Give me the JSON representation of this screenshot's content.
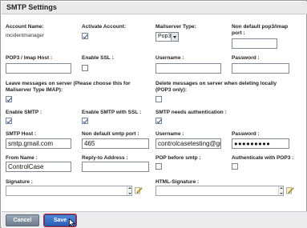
{
  "window": {
    "title": "SMTP Settings"
  },
  "fields": {
    "account_name": {
      "label": "Account Name:",
      "value": "incidentmanager"
    },
    "activate_account": {
      "label": "Activate Account:",
      "checked": true
    },
    "mailserver_type": {
      "label": "Mailserver Type:",
      "value": "Pop3"
    },
    "non_default_pop3_port": {
      "label": "Non default pop3/imap port :",
      "value": ""
    },
    "pop3_host": {
      "label": "POP3 / Imap Host :",
      "value": ""
    },
    "enable_ssl": {
      "label": "Enable SSL :",
      "checked": false
    },
    "username_pop": {
      "label": "Username :",
      "value": ""
    },
    "password_pop": {
      "label": "Password :",
      "value": ""
    },
    "leave_messages": {
      "label": "Leave messages on server (Please choose this for Mailserver Type IMAP):",
      "checked": true
    },
    "delete_messages": {
      "label": "Delete messages on server when deleting locally (POP3 only):",
      "checked": false
    },
    "enable_smtp": {
      "label": "Enable SMTP :",
      "checked": true
    },
    "enable_smtp_ssl": {
      "label": "Enable SMTP with SSL :",
      "checked": true
    },
    "smtp_needs_auth": {
      "label": "SMTP needs authentication :",
      "checked": true
    },
    "smtp_host": {
      "label": "SMTP Host :",
      "value": "smtp.gmail.com"
    },
    "non_default_smtp_port": {
      "label": "Non default smtp port :",
      "value": "465"
    },
    "username_smtp": {
      "label": "Username :",
      "value": "controlcasetesting@gmai"
    },
    "password_smtp": {
      "label": "Password :",
      "value": "●●●●●●●●●"
    },
    "from_name": {
      "label": "From Name :",
      "value": "ControlCase"
    },
    "reply_to": {
      "label": "Reply-to Address :",
      "value": ""
    },
    "pop_before_smtp": {
      "label": "POP before smtp :",
      "checked": false
    },
    "auth_with_pop3": {
      "label": "Authenticate with POP3 :",
      "checked": false
    },
    "signature": {
      "label": "Signature :"
    },
    "html_signature": {
      "label": "HTML-Signature :"
    }
  },
  "buttons": {
    "cancel": "Cancel",
    "save": "Save"
  },
  "icons": {
    "edit": "edit-pencil-icon",
    "cursor": "mouse-cursor-icon"
  },
  "colors": {
    "save_button": "#2c5fb6",
    "cancel_button": "#6e7b8c",
    "highlight": "#c9232b"
  }
}
